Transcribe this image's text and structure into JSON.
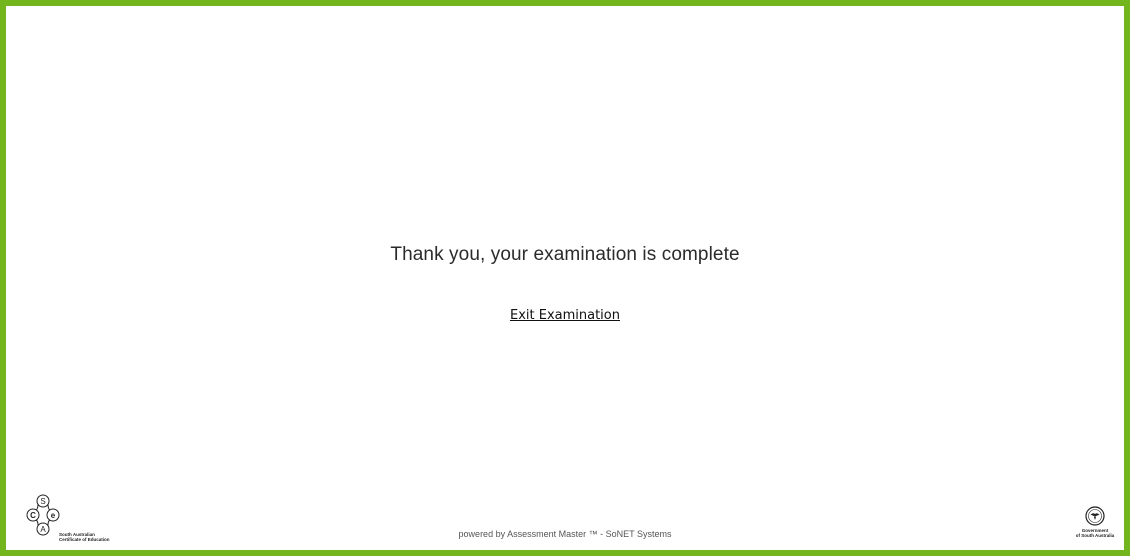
{
  "page": {
    "accent_color": "#72b51c"
  },
  "main": {
    "message": "Thank you, your examination is complete",
    "exit_label": "Exit Examination"
  },
  "footer": {
    "powered_by": "powered by Assessment Master ™ - SoNET Systems",
    "sace_logo": {
      "letters": [
        "S",
        "C",
        "e",
        "A"
      ],
      "line1": "South Australian",
      "line2": "Certificate of Education"
    },
    "gov_logo": {
      "icon": "piping-shrike-emblem",
      "line1": "Government",
      "line2": "of South Australia"
    }
  }
}
